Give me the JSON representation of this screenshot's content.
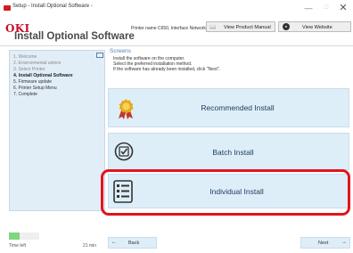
{
  "window": {
    "title": "Setup - Install Optional Software -",
    "minimize": "—",
    "maximize": "□",
    "close": "✕"
  },
  "header": {
    "logo": "OKI",
    "title": "Install Optional Software",
    "printer_info": "Printer name C650, Interface Network",
    "manual_button": "View Product Manual",
    "website_button": "View Website",
    "brand_color": "#c8102e"
  },
  "sidebar": {
    "steps": [
      "1. Welcome",
      "2. Environmental advice",
      "3. Select Printer",
      "4. Install Optional Software",
      "5. Firmware update",
      "6. Printer Setup Menu",
      "7. Complete"
    ],
    "active_step": 4
  },
  "progress": {
    "fraction": 0.35,
    "time_label": "Time left",
    "time_value": "21 min"
  },
  "main": {
    "screens_title": "Screens",
    "instructions": [
      "Install the software on the computer.",
      "Select the preferred installation method.",
      "If the software has already been installed, click \"Next\"."
    ],
    "options": [
      {
        "label": "Recommended Install",
        "icon": "award-ribbon-icon"
      },
      {
        "label": "Batch Install",
        "icon": "batch-checklist-icon"
      },
      {
        "label": "Individual Install",
        "icon": "individual-list-icon",
        "highlighted": true
      }
    ],
    "highlight_color": "#e2141c"
  },
  "footer": {
    "back": "Back",
    "next": "Next",
    "back_arrow": "←",
    "next_arrow": "→"
  }
}
